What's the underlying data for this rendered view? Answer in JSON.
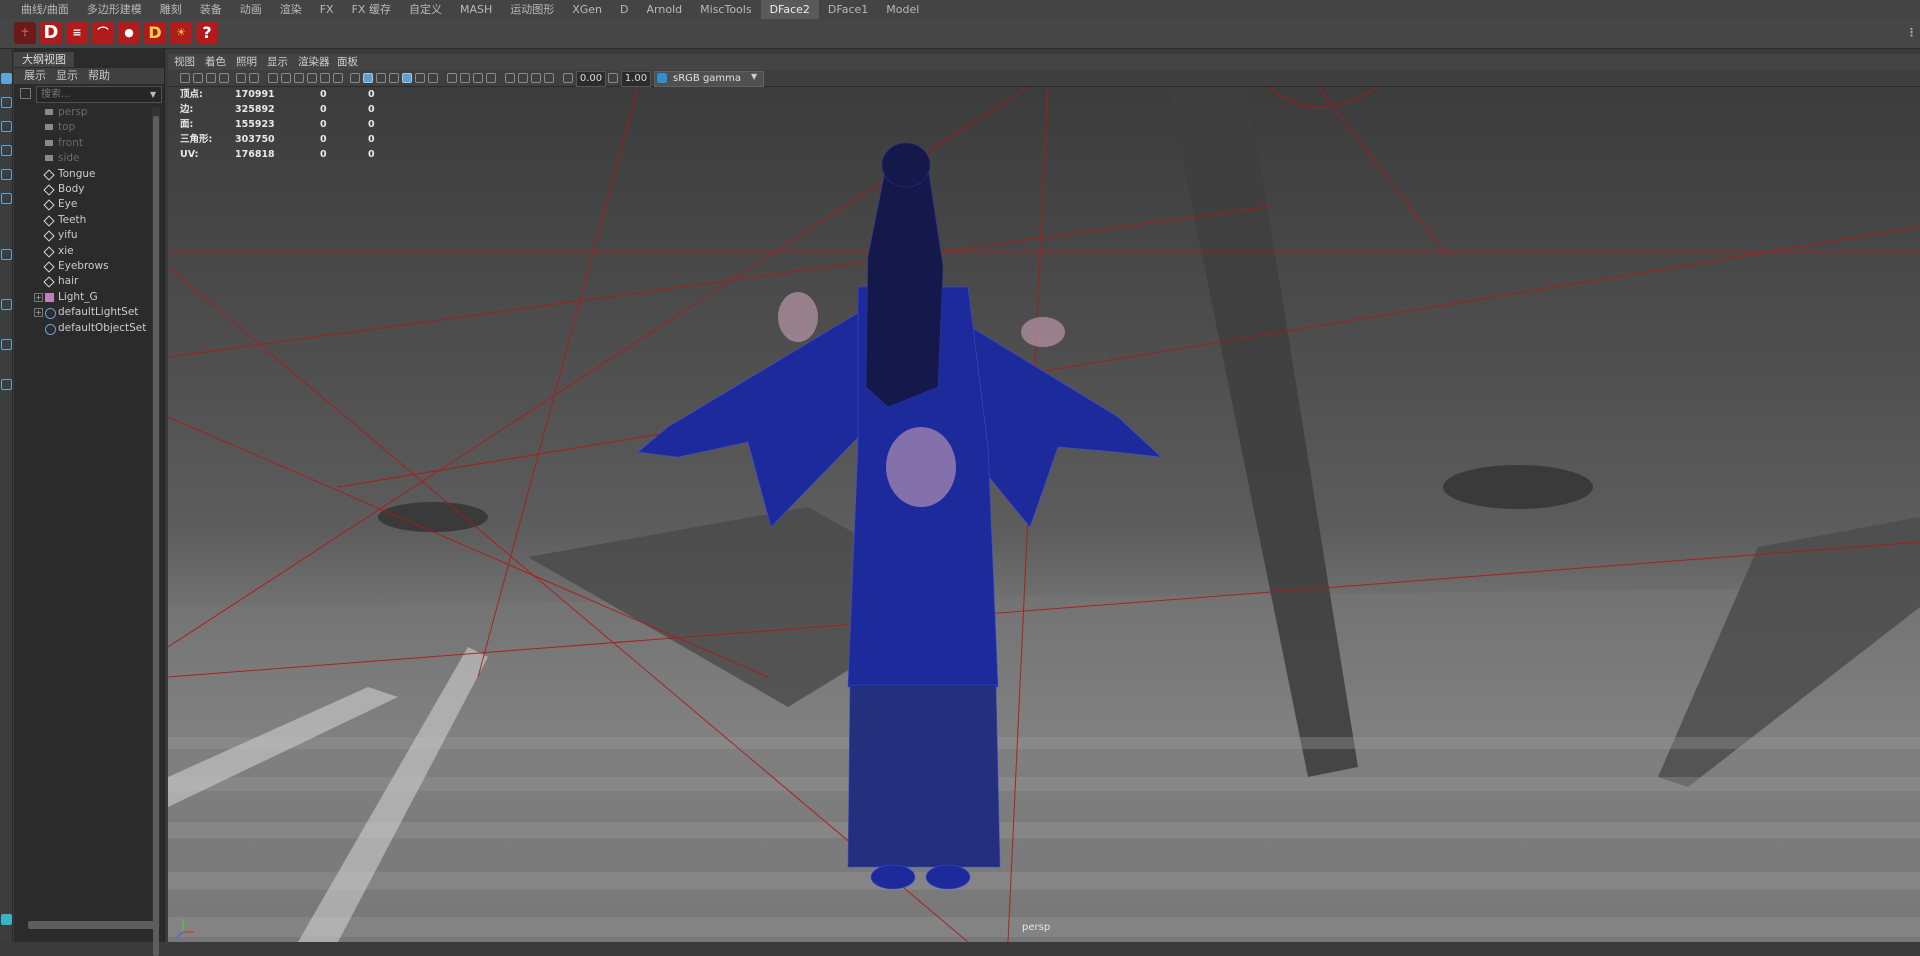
{
  "shelf_tabs": [
    "曲线/曲面",
    "多边形建模",
    "雕刻",
    "装备",
    "动画",
    "渲染",
    "FX",
    "FX 缓存",
    "自定义",
    "MASH",
    "运动图形",
    "XGen",
    "D",
    "Arnold",
    "MiscTools",
    "DFace2",
    "DFace1",
    "Model"
  ],
  "active_shelf_tab": "DFace2",
  "outliner": {
    "title": "大纲视图",
    "menu": [
      "展示",
      "显示",
      "帮助"
    ],
    "search_placeholder": "搜索...",
    "items": [
      {
        "label": "persp",
        "type": "camera",
        "hidden": true
      },
      {
        "label": "top",
        "type": "camera",
        "hidden": true
      },
      {
        "label": "front",
        "type": "camera",
        "hidden": true
      },
      {
        "label": "side",
        "type": "camera",
        "hidden": true
      },
      {
        "label": "Tongue",
        "type": "mesh",
        "hidden": false
      },
      {
        "label": "Body",
        "type": "mesh",
        "hidden": false
      },
      {
        "label": "Eye",
        "type": "mesh",
        "hidden": false
      },
      {
        "label": "Teeth",
        "type": "mesh",
        "hidden": false
      },
      {
        "label": "yifu",
        "type": "mesh",
        "hidden": false
      },
      {
        "label": "xie",
        "type": "mesh",
        "hidden": false
      },
      {
        "label": "Eyebrows",
        "type": "mesh",
        "hidden": false
      },
      {
        "label": "hair",
        "type": "mesh",
        "hidden": false
      },
      {
        "label": "Light_G",
        "type": "group",
        "hidden": false,
        "expandable": true
      },
      {
        "label": "defaultLightSet",
        "type": "set",
        "hidden": false,
        "expandable": true
      },
      {
        "label": "defaultObjectSet",
        "type": "set",
        "hidden": false
      }
    ]
  },
  "panel_menu": [
    "视图",
    "着色",
    "照明",
    "显示",
    "渲染器",
    "面板"
  ],
  "panel_toolbar": {
    "exposure": "0.00",
    "gamma": "1.00",
    "color_space": "sRGB gamma"
  },
  "hud": {
    "rows": [
      {
        "label": "顶点:",
        "v1": "170991",
        "v2": "0",
        "v3": "0"
      },
      {
        "label": "边:",
        "v1": "325892",
        "v2": "0",
        "v3": "0"
      },
      {
        "label": "面:",
        "v1": "155923",
        "v2": "0",
        "v3": "0"
      },
      {
        "label": "三角形:",
        "v1": "303750",
        "v2": "0",
        "v3": "0"
      },
      {
        "label": "UV:",
        "v1": "176818",
        "v2": "0",
        "v3": "0"
      }
    ]
  },
  "camera_label": "persp",
  "colors": {
    "wire_blue": "#1c2a9c",
    "grid_red": "#b01818",
    "accent": "#5f9fd0"
  }
}
